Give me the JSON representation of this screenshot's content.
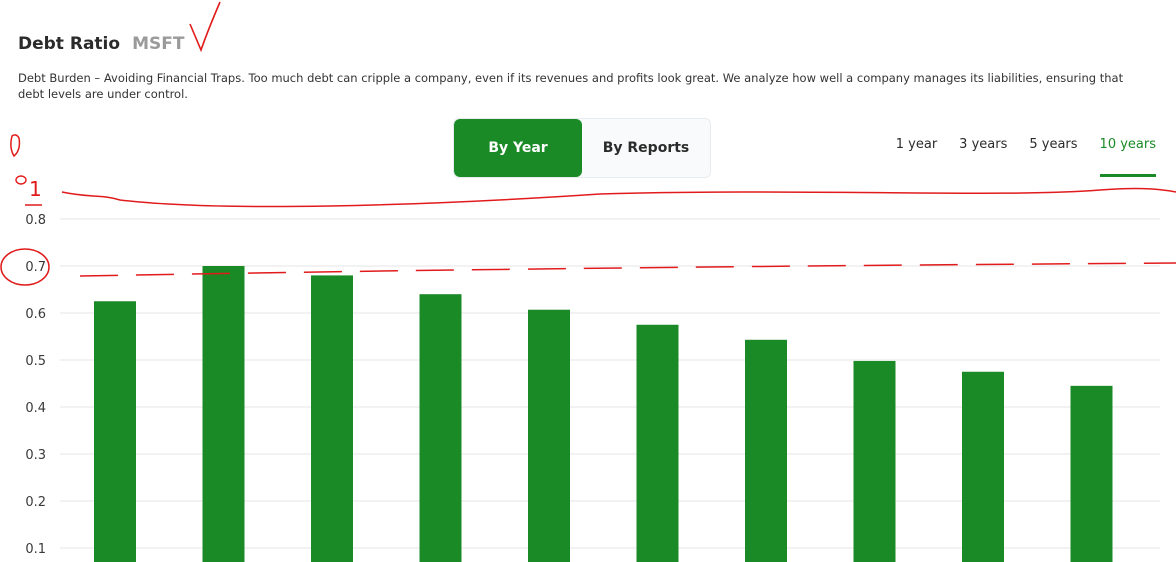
{
  "header": {
    "title": "Debt Ratio",
    "ticker": "MSFT"
  },
  "description": "Debt Burden – Avoiding Financial Traps. Too much debt can cripple a company, even if its revenues and profits look great. We analyze how well a company manages its liabilities, ensuring that debt levels are under control.",
  "view_toggle": {
    "by_year": "By Year",
    "by_reports": "By Reports",
    "selected": "By Year"
  },
  "ranges": {
    "items": [
      "1 year",
      "3 years",
      "5 years",
      "10 years"
    ],
    "selected": "10 years"
  },
  "colors": {
    "accent": "#1a8a26",
    "annotation": "#e11b1b",
    "grid": "#e6e6e6"
  },
  "chart_data": {
    "type": "bar",
    "values": [
      0.625,
      0.7,
      0.68,
      0.64,
      0.607,
      0.575,
      0.543,
      0.498,
      0.475,
      0.445
    ],
    "yticks": [
      "0.8",
      "0.7",
      "0.6",
      "0.5",
      "0.4",
      "0.3",
      "0.2",
      "0.1"
    ],
    "ylim": [
      0.075,
      0.875
    ],
    "grid": true,
    "bar_color": "#1a8a26"
  },
  "annotations": {
    "handwritten_marks": [
      "1"
    ]
  }
}
